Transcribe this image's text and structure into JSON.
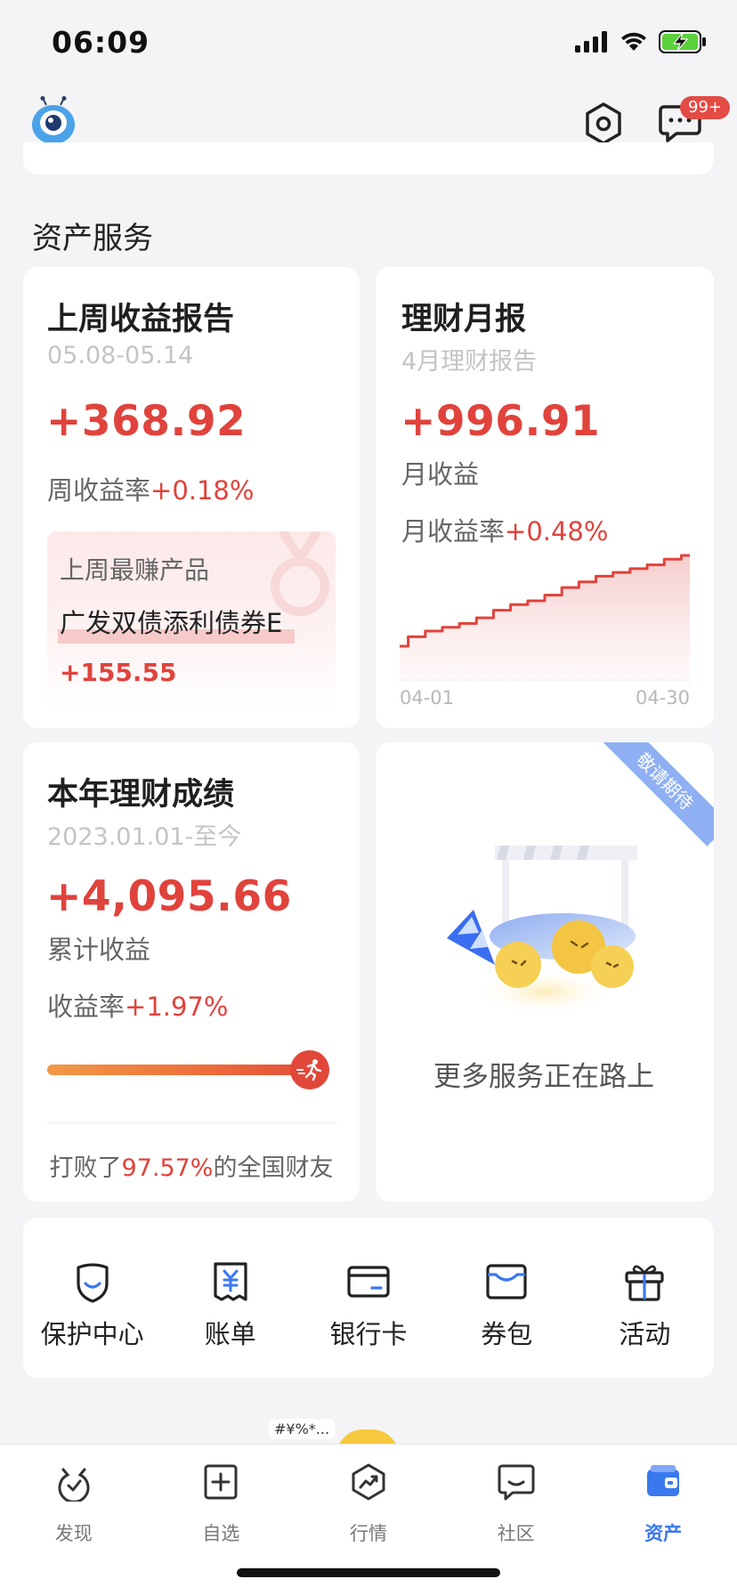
{
  "status": {
    "time": "06:09"
  },
  "header": {
    "badge": "99+"
  },
  "section": {
    "title": "资产服务"
  },
  "weekly": {
    "title": "上周收益报告",
    "date_range": "05.08-05.14",
    "amount": "+368.92",
    "rate_label": "周收益率",
    "rate_value": "+0.18%",
    "best_title": "上周最赚产品",
    "best_name": "广发双债添利债券E",
    "best_value": "+155.55"
  },
  "monthly": {
    "title": "理财月报",
    "subtitle": "4月理财报告",
    "amount": "+996.91",
    "amount_label": "月收益",
    "rate_label": "月收益率",
    "rate_value": "+0.48%",
    "x_start": "04-01",
    "x_end": "04-30"
  },
  "chart_data": {
    "type": "area",
    "title": "",
    "xlabel": "",
    "ylabel": "",
    "x_ticks": [
      "04-01",
      "04-30"
    ],
    "values": [
      0.0,
      0.05,
      0.08,
      0.1,
      0.12,
      0.15,
      0.19,
      0.22,
      0.24,
      0.27,
      0.31,
      0.34,
      0.37,
      0.39,
      0.41,
      0.43,
      0.46,
      0.48
    ],
    "grid": false,
    "color": "#e0433c"
  },
  "yearly": {
    "title": "本年理财成绩",
    "subtitle": "2023.01.01-至今",
    "amount": "+4,095.66",
    "amount_label": "累计收益",
    "rate_label": "收益率",
    "rate_value": "+1.97%",
    "beat_prefix": "打败了",
    "beat_value": "97.57%",
    "beat_suffix": "的全国财友",
    "beat_progress": 0.9757
  },
  "coming": {
    "ribbon": "敬请期待",
    "text": "更多服务正在路上"
  },
  "quick_links": [
    {
      "label": "保护中心",
      "icon": "shield-icon"
    },
    {
      "label": "账单",
      "icon": "bill-icon"
    },
    {
      "label": "银行卡",
      "icon": "bank-card-icon"
    },
    {
      "label": "券包",
      "icon": "coupon-wallet-icon"
    },
    {
      "label": "活动",
      "icon": "gift-icon"
    }
  ],
  "floating": {
    "tag": "#¥%*..."
  },
  "tabs": [
    {
      "label": "发现",
      "icon": "discover-icon",
      "active": false
    },
    {
      "label": "自选",
      "icon": "watchlist-icon",
      "active": false
    },
    {
      "label": "行情",
      "icon": "market-icon",
      "active": false
    },
    {
      "label": "社区",
      "icon": "community-icon",
      "active": false
    },
    {
      "label": "资产",
      "icon": "assets-wallet-icon",
      "active": true
    }
  ],
  "colors": {
    "accent_red": "#e0433c",
    "accent_blue": "#3a78f0"
  }
}
